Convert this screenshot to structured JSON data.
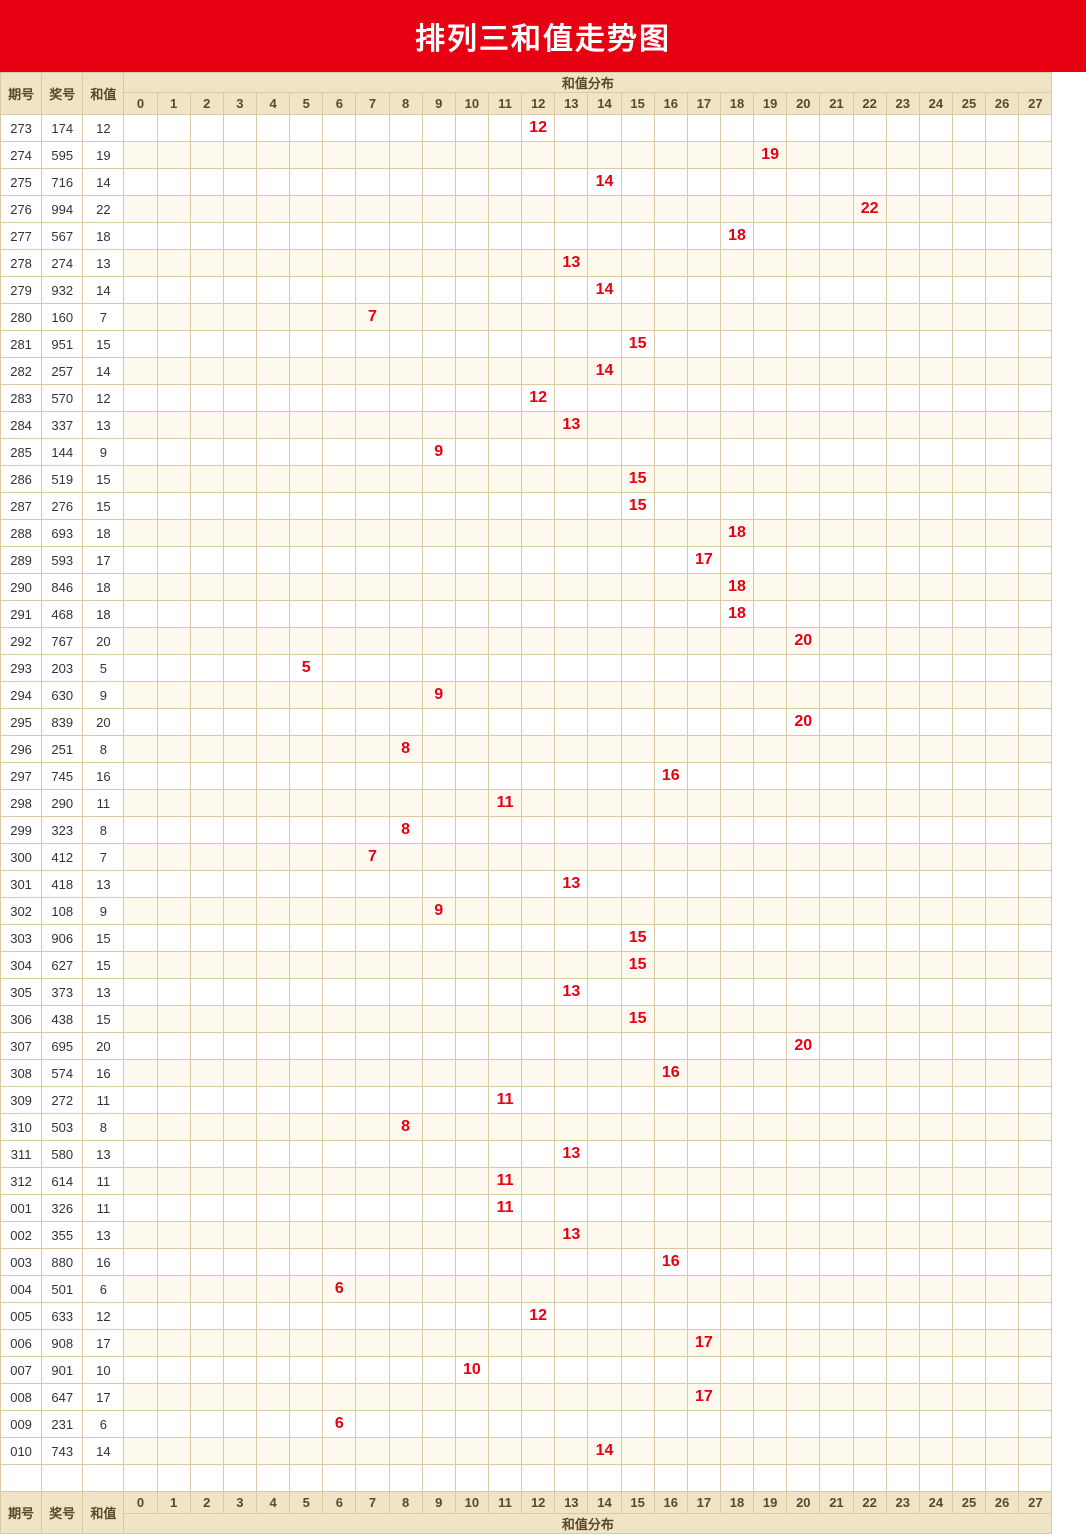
{
  "title": "排列三和值走势图",
  "headers": {
    "period": "期号",
    "award": "奖号",
    "sum": "和值",
    "distribution": "和值分布"
  },
  "columns": [
    0,
    1,
    2,
    3,
    4,
    5,
    6,
    7,
    8,
    9,
    10,
    11,
    12,
    13,
    14,
    15,
    16,
    17,
    18,
    19,
    20,
    21,
    22,
    23,
    24,
    25,
    26,
    27
  ],
  "rows": [
    {
      "period": "273",
      "award": "174",
      "sum": 12
    },
    {
      "period": "274",
      "award": "595",
      "sum": 19
    },
    {
      "period": "275",
      "award": "716",
      "sum": 14
    },
    {
      "period": "276",
      "award": "994",
      "sum": 22
    },
    {
      "period": "277",
      "award": "567",
      "sum": 18
    },
    {
      "period": "278",
      "award": "274",
      "sum": 13
    },
    {
      "period": "279",
      "award": "932",
      "sum": 14
    },
    {
      "period": "280",
      "award": "160",
      "sum": 7
    },
    {
      "period": "281",
      "award": "951",
      "sum": 15
    },
    {
      "period": "282",
      "award": "257",
      "sum": 14
    },
    {
      "period": "283",
      "award": "570",
      "sum": 12
    },
    {
      "period": "284",
      "award": "337",
      "sum": 13
    },
    {
      "period": "285",
      "award": "144",
      "sum": 9
    },
    {
      "period": "286",
      "award": "519",
      "sum": 15
    },
    {
      "period": "287",
      "award": "276",
      "sum": 15
    },
    {
      "period": "288",
      "award": "693",
      "sum": 18
    },
    {
      "period": "289",
      "award": "593",
      "sum": 17
    },
    {
      "period": "290",
      "award": "846",
      "sum": 18
    },
    {
      "period": "291",
      "award": "468",
      "sum": 18
    },
    {
      "period": "292",
      "award": "767",
      "sum": 20
    },
    {
      "period": "293",
      "award": "203",
      "sum": 5
    },
    {
      "period": "294",
      "award": "630",
      "sum": 9
    },
    {
      "period": "295",
      "award": "839",
      "sum": 20
    },
    {
      "period": "296",
      "award": "251",
      "sum": 8
    },
    {
      "period": "297",
      "award": "745",
      "sum": 16
    },
    {
      "period": "298",
      "award": "290",
      "sum": 11
    },
    {
      "period": "299",
      "award": "323",
      "sum": 8
    },
    {
      "period": "300",
      "award": "412",
      "sum": 7
    },
    {
      "period": "301",
      "award": "418",
      "sum": 13
    },
    {
      "period": "302",
      "award": "108",
      "sum": 9
    },
    {
      "period": "303",
      "award": "906",
      "sum": 15
    },
    {
      "period": "304",
      "award": "627",
      "sum": 15
    },
    {
      "period": "305",
      "award": "373",
      "sum": 13
    },
    {
      "period": "306",
      "award": "438",
      "sum": 15
    },
    {
      "period": "307",
      "award": "695",
      "sum": 20
    },
    {
      "period": "308",
      "award": "574",
      "sum": 16
    },
    {
      "period": "309",
      "award": "272",
      "sum": 11
    },
    {
      "period": "310",
      "award": "503",
      "sum": 8
    },
    {
      "period": "311",
      "award": "580",
      "sum": 13
    },
    {
      "period": "312",
      "award": "614",
      "sum": 11
    },
    {
      "period": "001",
      "award": "326",
      "sum": 11
    },
    {
      "period": "002",
      "award": "355",
      "sum": 13
    },
    {
      "period": "003",
      "award": "880",
      "sum": 16
    },
    {
      "period": "004",
      "award": "501",
      "sum": 6
    },
    {
      "period": "005",
      "award": "633",
      "sum": 12
    },
    {
      "period": "006",
      "award": "908",
      "sum": 17
    },
    {
      "period": "007",
      "award": "901",
      "sum": 10
    },
    {
      "period": "008",
      "award": "647",
      "sum": 17
    },
    {
      "period": "009",
      "award": "231",
      "sum": 6
    },
    {
      "period": "010",
      "award": "743",
      "sum": 14
    }
  ],
  "chart_data": {
    "type": "table",
    "title": "排列三和值走势图",
    "xlabel": "和值分布 (0–27)",
    "ylabel": "期号",
    "series": [
      {
        "name": "和值",
        "values": [
          12,
          19,
          14,
          22,
          18,
          13,
          14,
          7,
          15,
          14,
          12,
          13,
          9,
          15,
          15,
          18,
          17,
          18,
          18,
          20,
          5,
          9,
          20,
          8,
          16,
          11,
          8,
          7,
          13,
          9,
          15,
          15,
          13,
          15,
          20,
          16,
          11,
          8,
          13,
          11,
          11,
          13,
          16,
          6,
          12,
          17,
          10,
          17,
          6,
          14
        ]
      }
    ],
    "categories": [
      "273",
      "274",
      "275",
      "276",
      "277",
      "278",
      "279",
      "280",
      "281",
      "282",
      "283",
      "284",
      "285",
      "286",
      "287",
      "288",
      "289",
      "290",
      "291",
      "292",
      "293",
      "294",
      "295",
      "296",
      "297",
      "298",
      "299",
      "300",
      "301",
      "302",
      "303",
      "304",
      "305",
      "306",
      "307",
      "308",
      "309",
      "310",
      "311",
      "312",
      "001",
      "002",
      "003",
      "004",
      "005",
      "006",
      "007",
      "008",
      "009",
      "010"
    ],
    "xlim": [
      0,
      27
    ]
  }
}
